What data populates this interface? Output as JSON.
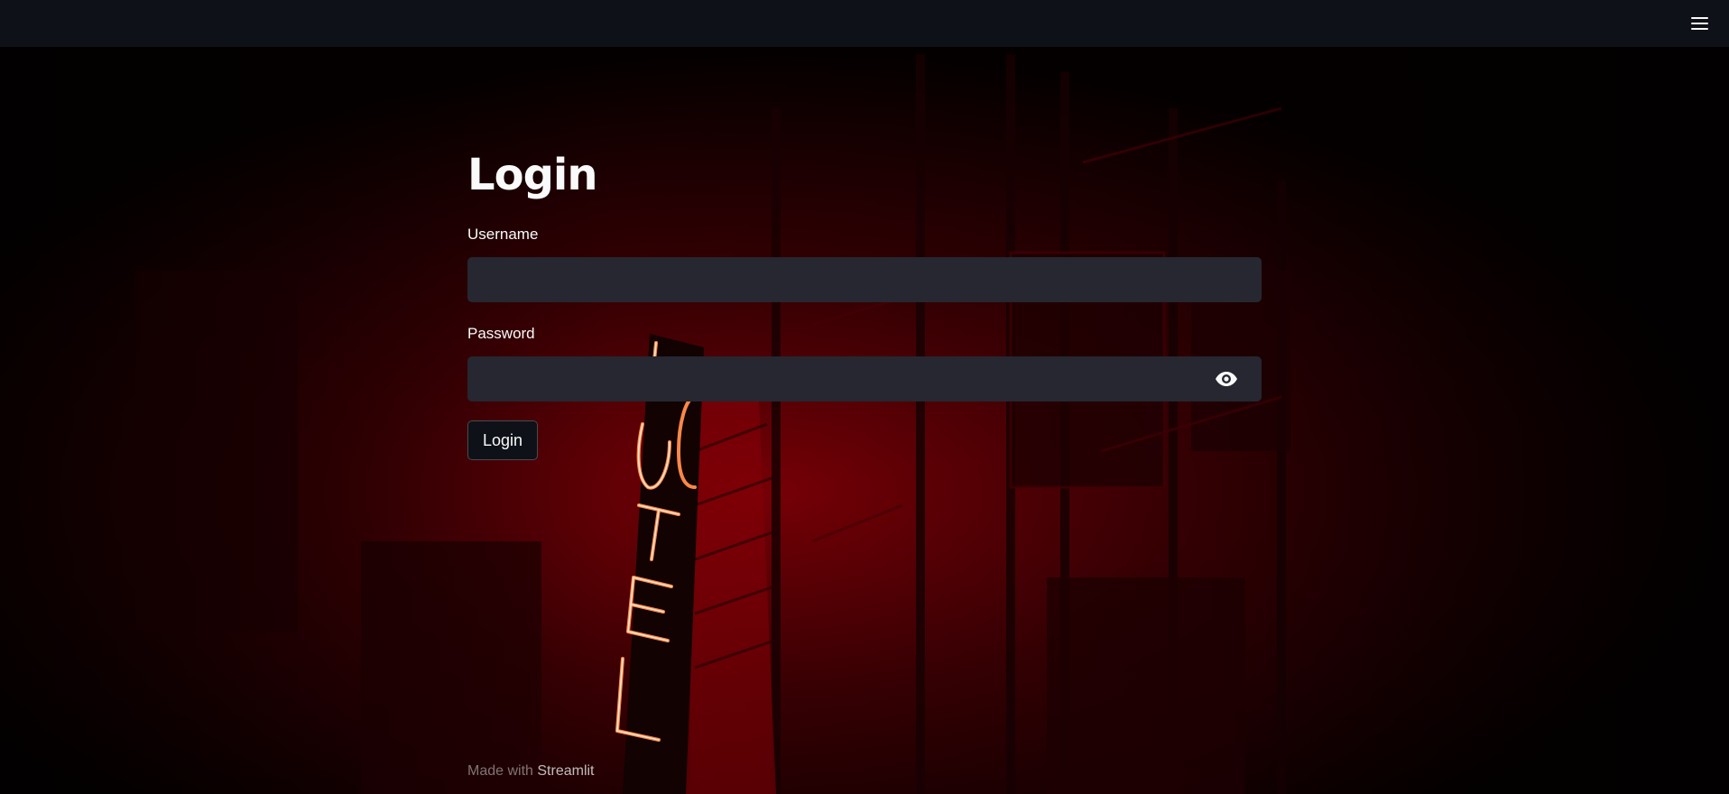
{
  "header": {
    "menu_icon": "hamburger-menu-icon"
  },
  "login": {
    "title": "Login",
    "username_label": "Username",
    "username_value": "",
    "password_label": "Password",
    "password_value": "",
    "toggle_icon": "eye-icon",
    "submit_label": "Login"
  },
  "background": {
    "sign_text": "HOTEL"
  },
  "footer": {
    "made_with": "Made with",
    "brand": "Streamlit"
  },
  "colors": {
    "topbar": "#0e1117",
    "input_bg": "#262730",
    "text": "#fafafa",
    "accent_red": "#8b0000"
  }
}
